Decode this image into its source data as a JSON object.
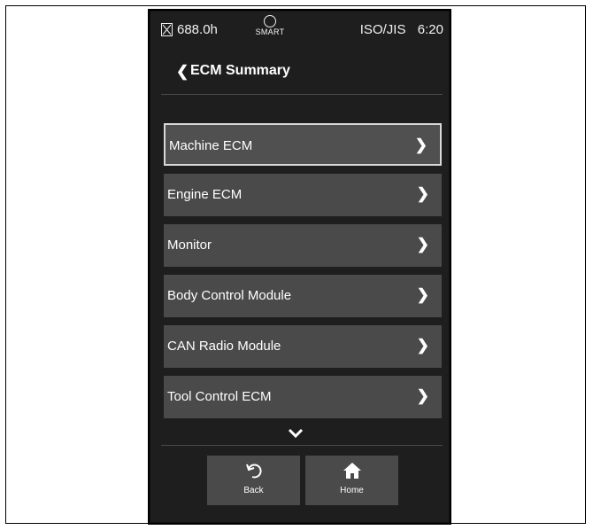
{
  "status": {
    "hours": "688.0h",
    "smart_label": "SMART",
    "standard": "ISO/JIS",
    "time": "6:20"
  },
  "header": {
    "title": "ECM Summary"
  },
  "menu": {
    "items": [
      {
        "label": "Machine ECM",
        "selected": true
      },
      {
        "label": "Engine ECM"
      },
      {
        "label": "Monitor"
      },
      {
        "label": "Body Control Module"
      },
      {
        "label": "CAN Radio Module"
      },
      {
        "label": "Tool Control ECM"
      }
    ]
  },
  "footer": {
    "back_label": "Back",
    "home_label": "Home"
  }
}
